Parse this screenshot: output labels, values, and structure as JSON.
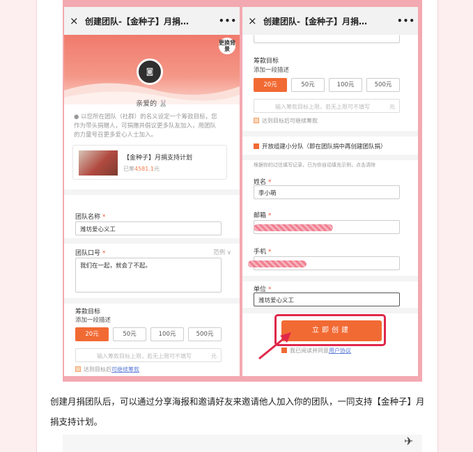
{
  "left_phone": {
    "nav_close": "×",
    "nav_title": "创建团队-【金种子】月捐…",
    "nav_more": "•••",
    "swap_bg": "更换背景",
    "nickname": "亲爱的 🐰",
    "desc": "以您所在团队（社群）的名义设定一个筹款目标，您作为带头捐赠人，可捐赠并倡议更多队友加入，用团队的力量号召更多爱心人士加入。",
    "project_title": "【金种子】月捐支持计划",
    "project_raised_prefix": "已筹",
    "project_raised_amount": "4581.1",
    "project_raised_unit": "元",
    "team_name_label": "团队名称",
    "team_name_value": "潍坊爱心义工",
    "team_slogan_label": "团队口号",
    "team_slogan_example": "范例 ∨",
    "team_slogan_value": "我们在一起，就会了不起。",
    "goal_label": "筹款目标",
    "goal_sub": "添加一段描述",
    "chips": [
      "20元",
      "50元",
      "100元",
      "500元"
    ],
    "amount_placeholder": "输入筹款目标上限，若无上限可不填写",
    "amount_unit": "元",
    "stop_label_prefix": "达到目标后",
    "stop_label_link": "可继续筹款"
  },
  "right_phone": {
    "nav_close": "×",
    "nav_title": "创建团队-【金种子】月捐…",
    "nav_more": "•••",
    "goal_label": "筹款目标",
    "goal_sub": "添加一段描述",
    "chips": [
      "20元",
      "50元",
      "100元",
      "500元"
    ],
    "amount_placeholder": "输入筹款目标上限，若无上限可不填写",
    "amount_unit": "元",
    "stop_label": "达到目标后可继续筹款",
    "subteam_label": "开放组建小分队（即在团队捐中再创建团队捐）",
    "history_note": "根据你的过往填写记录，已为你自动填充示例，点击清除",
    "name_label": "姓名",
    "name_value": "李小萌",
    "email_label": "邮箱",
    "phone_label": "手机",
    "unit_label": "单位",
    "unit_value": "潍坊爱心义工",
    "submit": "立即创建",
    "agree_prefix": "我已阅读并同意",
    "agree_link": "用户协议"
  },
  "caption": "创建月捐团队后，可以通过分享海报和邀请好友来邀请他人加入你的团队，一同支持【金种子】月捐支持计划。",
  "required_mark": "*",
  "colors": {
    "accent": "#f26a33",
    "highlight": "#e0284a",
    "frame": "#f3a9b1"
  }
}
